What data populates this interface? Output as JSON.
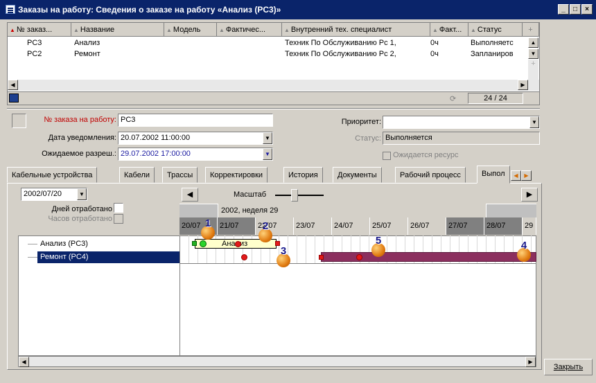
{
  "window": {
    "title": "Заказы на работу: Сведения о заказе на работу «Анализ (PC3)»",
    "close_button": "Закрыть"
  },
  "grid": {
    "columns": [
      "№ заказ...",
      "Название",
      "Модель",
      "Фактичес...",
      "Внутренний тех. специалист",
      "Факт...",
      "Статус"
    ],
    "rows": [
      [
        "PC3",
        "Анализ",
        "",
        "",
        "Техник По Обслуживанию Pc 1,",
        "0ч",
        "Выполняетс"
      ],
      [
        "PC2",
        "Ремонт",
        "",
        "",
        "Техник По Обслуживанию Pc 2,",
        "0ч",
        "Запланиров"
      ]
    ],
    "counter": "24 / 24"
  },
  "form": {
    "order_label": "№ заказа на работу:",
    "order_value": "PC3",
    "notify_label": "Дата уведомления:",
    "notify_value": "20.07.2002 11:00:00",
    "expected_label": "Ожидаемое разреш.:",
    "expected_value": "29.07.2002 17:00:00",
    "priority_label": "Приоритет:",
    "priority_value": "",
    "status_label": "Статус:",
    "status_value": "Выполняется",
    "resource_label": "Ожидается ресурс"
  },
  "tabs": [
    "Кабельные устройства",
    "Кабели",
    "Трассы",
    "Корректировки",
    "История",
    "Документы",
    "Рабочий процесс",
    "Выпол"
  ],
  "gantt": {
    "date_select": "2002/07/20",
    "days_label": "Дней отработано",
    "hours_label": "Часов отработано",
    "scale_label": "Масштаб",
    "week_label": "2002, неделя 29",
    "dates": [
      "20/07",
      "21/07",
      "22/07",
      "23/07",
      "24/07",
      "25/07",
      "26/07",
      "27/07",
      "28/07",
      "29"
    ],
    "tasks": [
      "Анализ (PC3)",
      "Ремонт (PC4)"
    ],
    "bar_label": "Анализ",
    "callouts": [
      "1",
      "2",
      "3",
      "4",
      "5"
    ]
  },
  "colors": {
    "titlebar": "#0a246a",
    "selection": "#0a246a",
    "bar_repair": "#8b2f5e",
    "bar_analysis": "#ffffcc"
  }
}
